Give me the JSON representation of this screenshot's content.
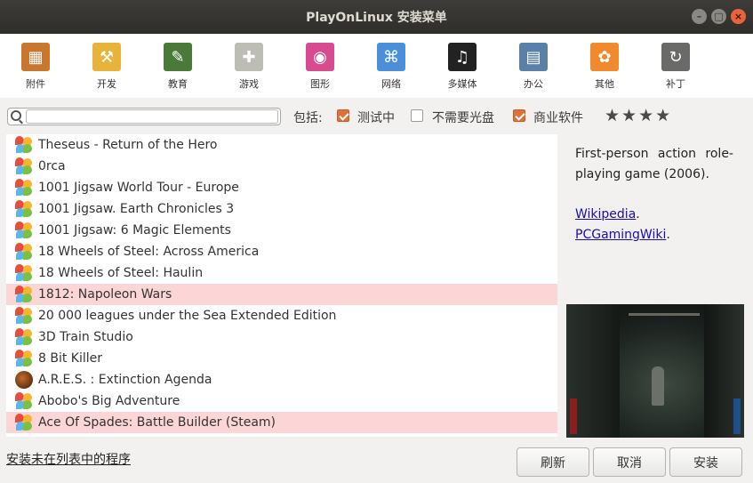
{
  "window": {
    "title": "PlayOnLinux 安装菜单"
  },
  "categories": [
    {
      "label": "附件",
      "icon": "accessories-icon",
      "color": "#c9772f"
    },
    {
      "label": "开发",
      "icon": "development-icon",
      "color": "#e8b33a"
    },
    {
      "label": "教育",
      "icon": "education-icon",
      "color": "#4a7a3a"
    },
    {
      "label": "游戏",
      "icon": "games-icon",
      "color": "#bdbdb6"
    },
    {
      "label": "图形",
      "icon": "graphics-icon",
      "color": "#d84b8f"
    },
    {
      "label": "网络",
      "icon": "network-icon",
      "color": "#4a8fd8"
    },
    {
      "label": "多媒体",
      "icon": "multimedia-icon",
      "color": "#222222"
    },
    {
      "label": "办公",
      "icon": "office-icon",
      "color": "#5a7fa8"
    },
    {
      "label": "其他",
      "icon": "other-icon",
      "color": "#f08a2c"
    },
    {
      "label": "补丁",
      "icon": "patches-icon",
      "color": "#6a6a68"
    }
  ],
  "filter": {
    "search_value": "",
    "include_label": "包括:",
    "options": [
      {
        "label": "测试中",
        "checked": true
      },
      {
        "label": "不需要光盘",
        "checked": false
      },
      {
        "label": "商业软件",
        "checked": true
      }
    ],
    "stars": "★★★★"
  },
  "games": [
    {
      "name": "Theseus - Return of the Hero",
      "highlight": false
    },
    {
      "name": "0rca",
      "highlight": false
    },
    {
      "name": "1001 Jigsaw World Tour - Europe",
      "highlight": false
    },
    {
      "name": "1001 Jigsaw. Earth Chronicles 3",
      "highlight": false
    },
    {
      "name": "1001 Jigsaw: 6 Magic Elements",
      "highlight": false
    },
    {
      "name": "18 Wheels of Steel: Across America",
      "highlight": false
    },
    {
      "name": "18 Wheels of Steel: Haulin",
      "highlight": false
    },
    {
      "name": "1812: Napoleon Wars",
      "highlight": true
    },
    {
      "name": "20 000 leagues under the Sea Extended Edition",
      "highlight": false
    },
    {
      "name": "3D Train Studio",
      "highlight": false
    },
    {
      "name": "8 Bit Killer",
      "highlight": false
    },
    {
      "name": "A.R.E.S. : Extinction Agenda",
      "highlight": false,
      "icon": "ares"
    },
    {
      "name": "Abobo's Big Adventure",
      "highlight": false
    },
    {
      "name": "Ace Of Spades: Battle Builder (Steam)",
      "highlight": true
    }
  ],
  "description": {
    "text": "First-person action role-playing game (2006).",
    "link1": "Wikipedia",
    "sep": ".",
    "link2": "PCGamingWiki",
    "end": "."
  },
  "bottom": {
    "manual_install": "安装未在列表中的程序",
    "refresh": "刷新",
    "cancel": "取消",
    "install": "安装"
  }
}
